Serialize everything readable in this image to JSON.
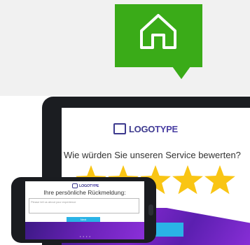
{
  "marker": {
    "icon": "home-icon",
    "color": "#3aab18"
  },
  "tablet": {
    "logo_part1": "LOGO",
    "logo_part2": "TYPE",
    "question": "Wie würden Sie unseren Service bewerten?",
    "rating": 5,
    "rating_max": 5,
    "star_color": "#f9c514"
  },
  "phone": {
    "logo_part1": "LOGO",
    "logo_part2": "TYPE",
    "prompt": "Ihre persönliche Rückmeldung:",
    "input_placeholder": "Please tell us about your experience",
    "button_label": "Next",
    "dots": "• • • •"
  },
  "colors": {
    "brand_purple": "#3d3a8e",
    "accent_blue": "#2ab3e6",
    "logo_yellow": "#f2b90f"
  }
}
